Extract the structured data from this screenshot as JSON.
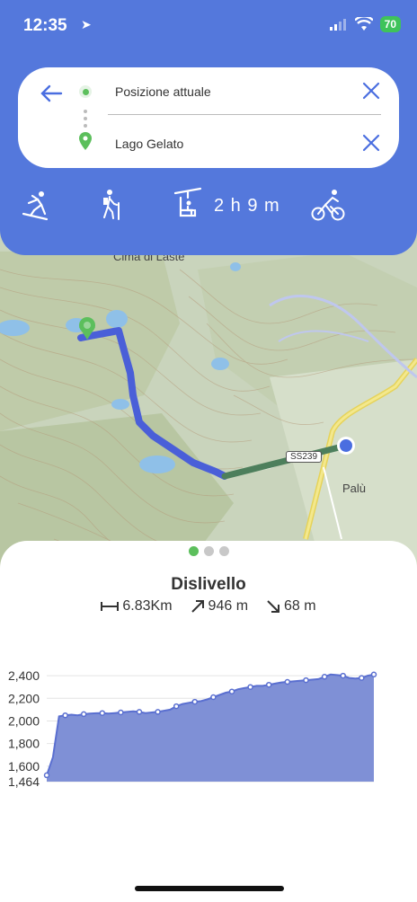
{
  "status": {
    "time": "12:35",
    "battery": "70"
  },
  "route": {
    "origin": "Posizione attuale",
    "destination": "Lago Gelato"
  },
  "modes": {
    "duration": "2 h 9 m",
    "icons": [
      "skier-icon",
      "hiker-icon",
      "chairlift-icon",
      "cyclist-icon"
    ]
  },
  "map": {
    "places": [
      "Cima di Laste",
      "Palù"
    ],
    "road": "SS239"
  },
  "sheet": {
    "title": "Dislivello",
    "distance": "6.83Km",
    "ascent": "946 m",
    "descent": "68 m",
    "pages": 3,
    "active_page": 0
  },
  "chart_data": {
    "type": "area",
    "ylim": [
      1464,
      2480
    ],
    "yticks": [
      "2,400",
      "2,200",
      "2,000",
      "1,800",
      "1,600",
      "1,464"
    ],
    "ytick_values": [
      2400,
      2200,
      2000,
      1800,
      1600,
      1464
    ],
    "series": [
      {
        "values": [
          1520,
          1680,
          2040,
          2050,
          2055,
          2050,
          2060,
          2065,
          2068,
          2070,
          2065,
          2070,
          2075,
          2080,
          2085,
          2080,
          2070,
          2075,
          2080,
          2090,
          2100,
          2130,
          2150,
          2160,
          2170,
          2175,
          2190,
          2210,
          2230,
          2250,
          2260,
          2280,
          2290,
          2300,
          2310,
          2310,
          2320,
          2330,
          2340,
          2345,
          2350,
          2355,
          2360,
          2365,
          2370,
          2390,
          2410,
          2405,
          2400,
          2380,
          2375,
          2380,
          2400,
          2410
        ]
      }
    ],
    "color": "#7f90d6"
  },
  "colors": {
    "accent": "#5478dc",
    "route": "#4a5fd8",
    "green": "#5cbf5c"
  }
}
